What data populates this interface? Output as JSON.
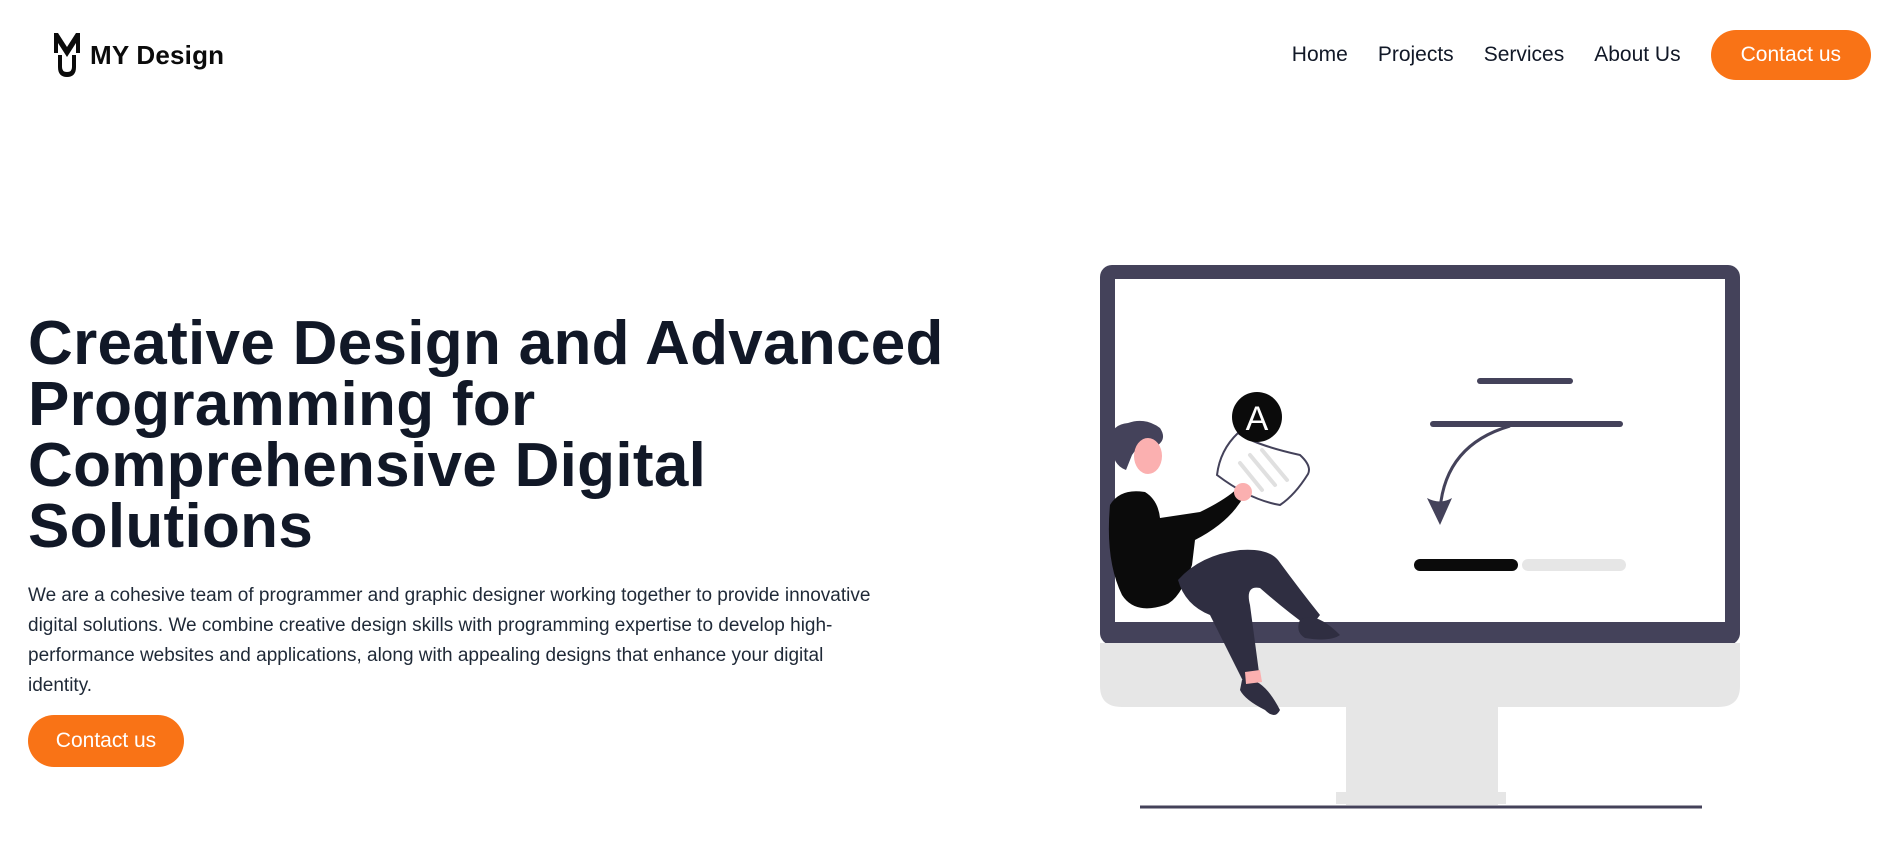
{
  "brand": {
    "logo_icon": "mj-monogram-icon",
    "name": "MY Design"
  },
  "nav": {
    "items": [
      {
        "label": "Home"
      },
      {
        "label": "Projects"
      },
      {
        "label": "Services"
      },
      {
        "label": "About Us"
      }
    ],
    "cta_label": "Contact us"
  },
  "hero": {
    "title_lines": [
      "Creative Design and Advanced",
      "Programming for",
      "Comprehensive Digital",
      "Solutions"
    ],
    "description_lines": [
      "We are a cohesive team of programmer and graphic designer working together to provide innovative",
      "digital solutions. We combine creative design skills with programming expertise to develop high-",
      "performance websites and applications, along with appealing designs that enhance your digital",
      "identity."
    ],
    "cta_label": "Contact us"
  },
  "illustration": {
    "badge_letter": "A",
    "icon": "designer-at-monitor-illustration"
  },
  "colors": {
    "accent": "#f97316",
    "text_dark": "#111827",
    "monitor_frame": "#44425a",
    "monitor_stand": "#e6e6e6"
  }
}
